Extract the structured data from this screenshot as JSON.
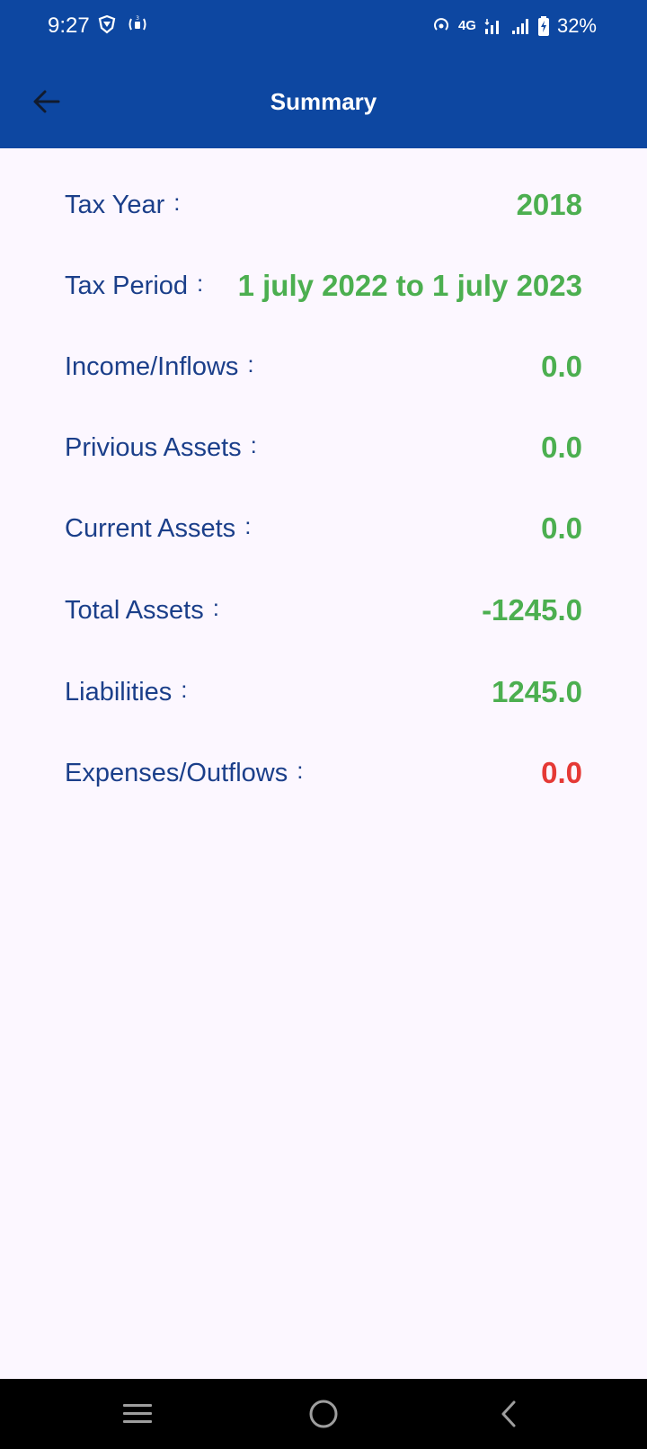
{
  "status_bar": {
    "time": "9:27",
    "network": "4G",
    "battery": "32%",
    "icons": [
      "shield-icon",
      "vibrate-icon",
      "hotspot-icon",
      "signal-icon",
      "signal-icon",
      "battery-charging-icon"
    ]
  },
  "app_bar": {
    "title": "Summary",
    "back_icon": "arrow-left-icon"
  },
  "summary": {
    "colon": ":",
    "rows": [
      {
        "label": "Tax Year",
        "value": "2018",
        "value_color": "#4caf50"
      },
      {
        "label": "Tax Period",
        "value": "1 july 2022 to 1 july 2023",
        "value_color": "#4caf50"
      },
      {
        "label": "Income/Inflows",
        "value": "0.0",
        "value_color": "#4caf50"
      },
      {
        "label": "Privious Assets",
        "value": "0.0",
        "value_color": "#4caf50"
      },
      {
        "label": "Current Assets",
        "value": "0.0",
        "value_color": "#4caf50"
      },
      {
        "label": "Total Assets",
        "value": "-1245.0",
        "value_color": "#4caf50"
      },
      {
        "label": "Liabilities",
        "value": "1245.0",
        "value_color": "#4caf50"
      },
      {
        "label": "Expenses/Outflows",
        "value": "0.0",
        "value_color": "#e53935"
      }
    ]
  },
  "nav_bar": {
    "icons": [
      "menu-icon",
      "home-icon",
      "back-icon"
    ]
  },
  "colors": {
    "primary": "#0d47a1",
    "label": "#1b3f8a",
    "positive": "#4caf50",
    "negative": "#e53935",
    "background": "#fcf7ff"
  }
}
